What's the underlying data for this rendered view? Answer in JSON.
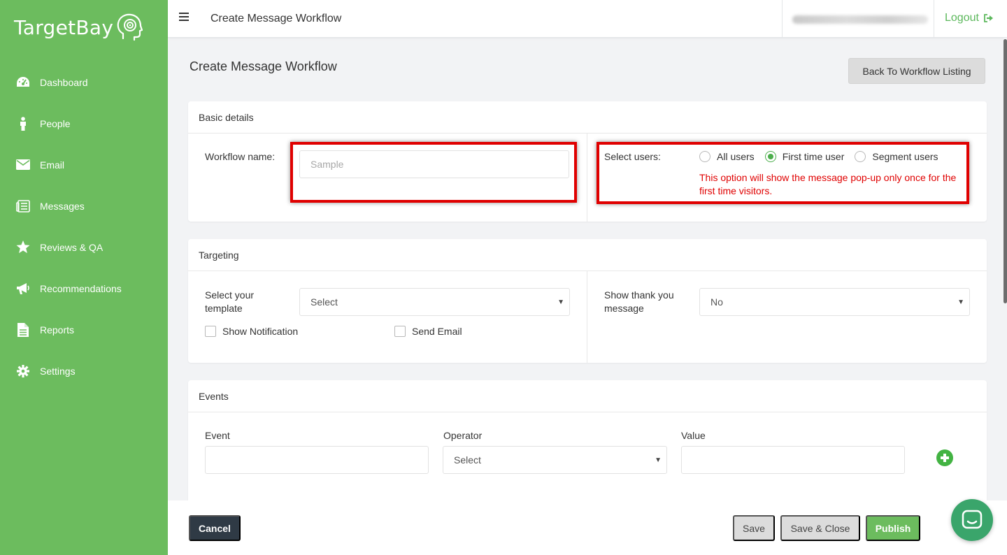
{
  "brand": {
    "name": "TargetBay",
    "accent": "#6cbc5e"
  },
  "sidebar": {
    "items": [
      {
        "label": "Dashboard",
        "icon": "dashboard-icon"
      },
      {
        "label": "People",
        "icon": "person-icon"
      },
      {
        "label": "Email",
        "icon": "envelope-icon"
      },
      {
        "label": "Messages",
        "icon": "messages-icon"
      },
      {
        "label": "Reviews & QA",
        "icon": "star-icon"
      },
      {
        "label": "Recommendations",
        "icon": "megaphone-icon"
      },
      {
        "label": "Reports",
        "icon": "document-icon"
      },
      {
        "label": "Settings",
        "icon": "gear-icon"
      }
    ]
  },
  "topbar": {
    "title": "Create Message Workflow",
    "logout_label": "Logout"
  },
  "main": {
    "title": "Create Message Workflow",
    "back_label": "Back To Workflow Listing",
    "basic": {
      "title": "Basic details",
      "workflow_name_label": "Workflow name:",
      "workflow_name_placeholder": "Sample",
      "select_users_label": "Select users:",
      "options": [
        "All users",
        "First time user",
        "Segment users"
      ],
      "selected": "First time user",
      "hint": "This option will show the message pop-up only once for the first time visitors."
    },
    "targeting": {
      "title": "Targeting",
      "template_label": "Select your template",
      "template_value": "Select",
      "show_notification_label": "Show Notification",
      "send_email_label": "Send Email",
      "thank_you_label": "Show thank you message",
      "thank_you_value": "No"
    },
    "events": {
      "title": "Events",
      "event_label": "Event",
      "operator_label": "Operator",
      "operator_value": "Select",
      "value_label": "Value"
    }
  },
  "footer": {
    "cancel_label": "Cancel",
    "save_label": "Save",
    "save_close_label": "Save & Close",
    "publish_label": "Publish"
  }
}
